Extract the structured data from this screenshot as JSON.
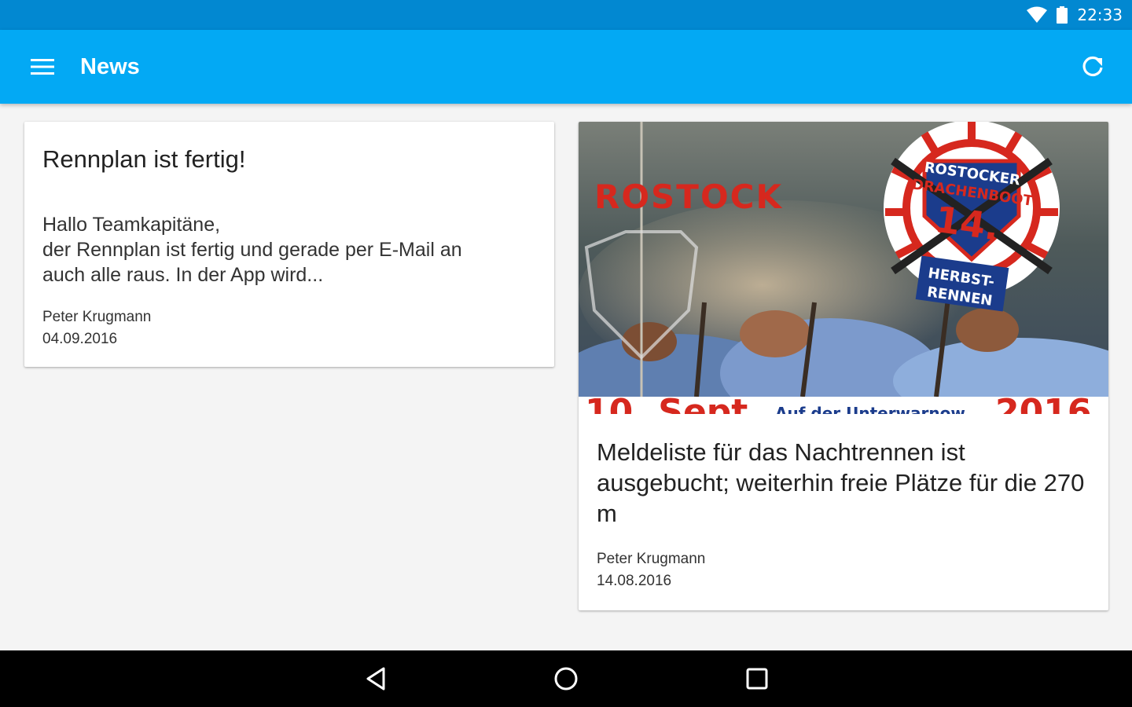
{
  "status_bar": {
    "time": "22:33",
    "icons": [
      "wifi-icon",
      "battery-icon"
    ]
  },
  "app_bar": {
    "title": "News",
    "menu_icon": "menu-icon",
    "refresh_icon": "refresh-icon",
    "color": "#03a9f4"
  },
  "news": [
    {
      "title": "Rennplan ist fertig!",
      "excerpt": "Hallo Teamkapitäne,\nder Rennplan ist fertig und gerade per E-Mail an\nauch alle raus. In der App wird...",
      "author": "Peter Krugmann",
      "date": "04.09.2016"
    },
    {
      "title": "Meldeliste für das Nachtrennen ist ausgebucht; weiterhin freie Plätze für die 270 m",
      "author": "Peter Krugmann",
      "date": "14.08.2016",
      "image": {
        "city": "ROSTOCK",
        "badge_top": "ROSTOCKER",
        "badge_mid": "DRACHENBOOT",
        "badge_number": "14.",
        "badge_bottom_1": "HERBST-",
        "badge_bottom_2": "RENNEN",
        "ribbon_left": "10. Sept",
        "ribbon_mid": "Auf der Unterwarnow",
        "ribbon_right": "2016"
      }
    }
  ],
  "nav_bar": {
    "icons": [
      "back-icon",
      "home-icon",
      "recents-icon"
    ]
  }
}
